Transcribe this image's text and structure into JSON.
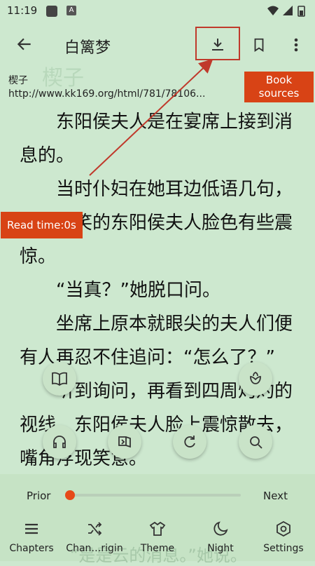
{
  "status_bar": {
    "time": "11:19",
    "notif_icon_letter": "A"
  },
  "toolbar": {
    "title": "白篱梦"
  },
  "meta": {
    "book_name": "楔子",
    "url": "http://www.kk169.org/html/781/78106...",
    "ghost_title": "楔子"
  },
  "book_sources_label": "Book sources",
  "read_time": "Read time:0s",
  "content": {
    "paragraphs": [
      "东阳侯夫人是在宴席上接到消息的。",
      "当时仆妇在她耳边低语几句，原本含笑的东阳侯夫人脸色有些震惊。",
      "“当真？”她脱口问。",
      "坐席上原本就眼尖的夫人们便有人再忍不住追问：“怎么了？”",
      "听到询问，再看到四周灼灼的视线，东阳侯夫人脸上震惊散去，嘴角浮现笑意。"
    ],
    "ghost_line": "“是是云的消息。”她说。"
  },
  "bottom": {
    "prior_label": "Prior",
    "next_label": "Next",
    "progress": 0.0,
    "nav": [
      {
        "label": "Chapters",
        "icon": "list-icon"
      },
      {
        "label": "Chan…rigin",
        "icon": "shuffle-icon"
      },
      {
        "label": "Theme",
        "icon": "shirt-icon"
      },
      {
        "label": "Night",
        "icon": "moon-icon"
      },
      {
        "label": "Settings",
        "icon": "settings-icon"
      }
    ]
  },
  "colors": {
    "background": "#cde8cf",
    "accent": "#d84315",
    "annotation": "#c0392b"
  }
}
